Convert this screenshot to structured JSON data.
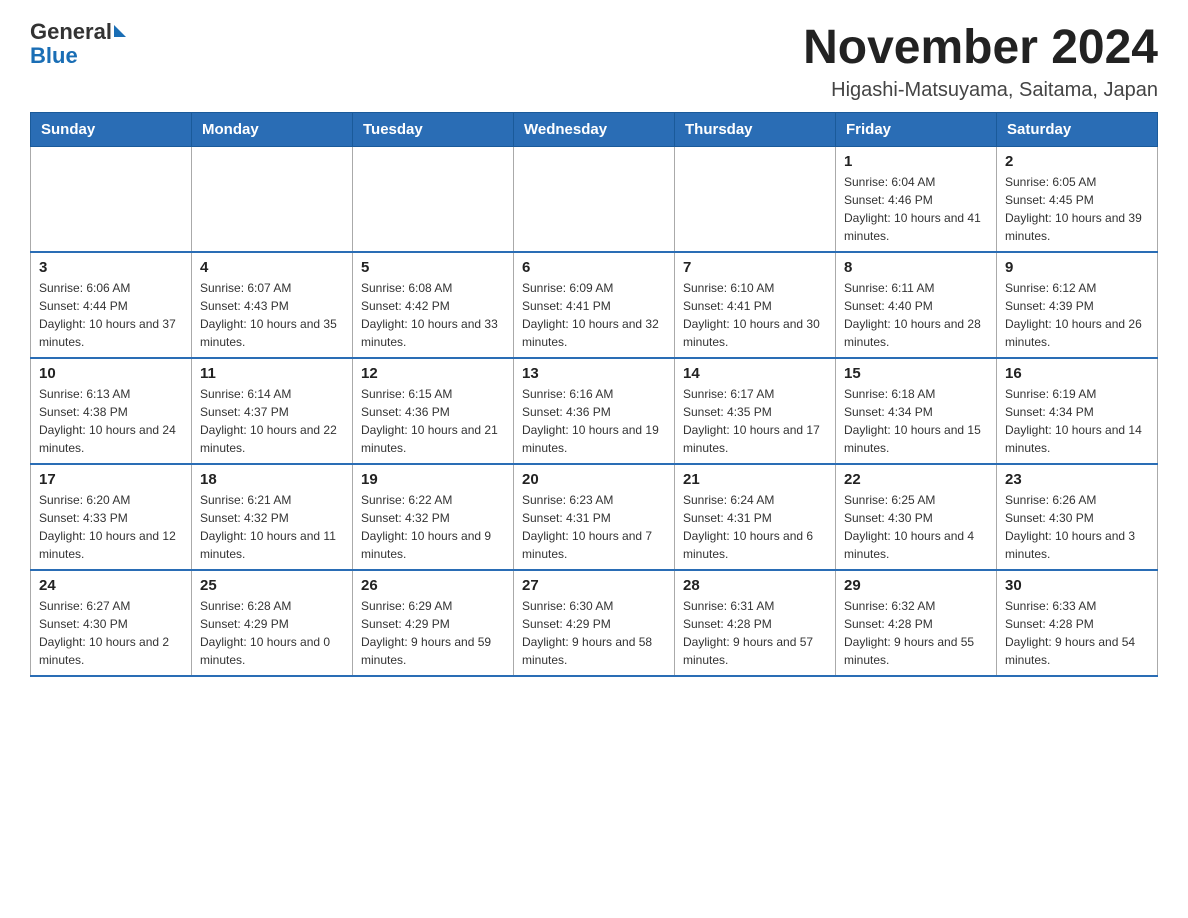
{
  "logo": {
    "text_general": "General",
    "text_blue": "Blue"
  },
  "header": {
    "month_title": "November 2024",
    "location": "Higashi-Matsuyama, Saitama, Japan"
  },
  "weekdays": [
    "Sunday",
    "Monday",
    "Tuesday",
    "Wednesday",
    "Thursday",
    "Friday",
    "Saturday"
  ],
  "weeks": [
    [
      {
        "day": "",
        "sunrise": "",
        "sunset": "",
        "daylight": ""
      },
      {
        "day": "",
        "sunrise": "",
        "sunset": "",
        "daylight": ""
      },
      {
        "day": "",
        "sunrise": "",
        "sunset": "",
        "daylight": ""
      },
      {
        "day": "",
        "sunrise": "",
        "sunset": "",
        "daylight": ""
      },
      {
        "day": "",
        "sunrise": "",
        "sunset": "",
        "daylight": ""
      },
      {
        "day": "1",
        "sunrise": "Sunrise: 6:04 AM",
        "sunset": "Sunset: 4:46 PM",
        "daylight": "Daylight: 10 hours and 41 minutes."
      },
      {
        "day": "2",
        "sunrise": "Sunrise: 6:05 AM",
        "sunset": "Sunset: 4:45 PM",
        "daylight": "Daylight: 10 hours and 39 minutes."
      }
    ],
    [
      {
        "day": "3",
        "sunrise": "Sunrise: 6:06 AM",
        "sunset": "Sunset: 4:44 PM",
        "daylight": "Daylight: 10 hours and 37 minutes."
      },
      {
        "day": "4",
        "sunrise": "Sunrise: 6:07 AM",
        "sunset": "Sunset: 4:43 PM",
        "daylight": "Daylight: 10 hours and 35 minutes."
      },
      {
        "day": "5",
        "sunrise": "Sunrise: 6:08 AM",
        "sunset": "Sunset: 4:42 PM",
        "daylight": "Daylight: 10 hours and 33 minutes."
      },
      {
        "day": "6",
        "sunrise": "Sunrise: 6:09 AM",
        "sunset": "Sunset: 4:41 PM",
        "daylight": "Daylight: 10 hours and 32 minutes."
      },
      {
        "day": "7",
        "sunrise": "Sunrise: 6:10 AM",
        "sunset": "Sunset: 4:41 PM",
        "daylight": "Daylight: 10 hours and 30 minutes."
      },
      {
        "day": "8",
        "sunrise": "Sunrise: 6:11 AM",
        "sunset": "Sunset: 4:40 PM",
        "daylight": "Daylight: 10 hours and 28 minutes."
      },
      {
        "day": "9",
        "sunrise": "Sunrise: 6:12 AM",
        "sunset": "Sunset: 4:39 PM",
        "daylight": "Daylight: 10 hours and 26 minutes."
      }
    ],
    [
      {
        "day": "10",
        "sunrise": "Sunrise: 6:13 AM",
        "sunset": "Sunset: 4:38 PM",
        "daylight": "Daylight: 10 hours and 24 minutes."
      },
      {
        "day": "11",
        "sunrise": "Sunrise: 6:14 AM",
        "sunset": "Sunset: 4:37 PM",
        "daylight": "Daylight: 10 hours and 22 minutes."
      },
      {
        "day": "12",
        "sunrise": "Sunrise: 6:15 AM",
        "sunset": "Sunset: 4:36 PM",
        "daylight": "Daylight: 10 hours and 21 minutes."
      },
      {
        "day": "13",
        "sunrise": "Sunrise: 6:16 AM",
        "sunset": "Sunset: 4:36 PM",
        "daylight": "Daylight: 10 hours and 19 minutes."
      },
      {
        "day": "14",
        "sunrise": "Sunrise: 6:17 AM",
        "sunset": "Sunset: 4:35 PM",
        "daylight": "Daylight: 10 hours and 17 minutes."
      },
      {
        "day": "15",
        "sunrise": "Sunrise: 6:18 AM",
        "sunset": "Sunset: 4:34 PM",
        "daylight": "Daylight: 10 hours and 15 minutes."
      },
      {
        "day": "16",
        "sunrise": "Sunrise: 6:19 AM",
        "sunset": "Sunset: 4:34 PM",
        "daylight": "Daylight: 10 hours and 14 minutes."
      }
    ],
    [
      {
        "day": "17",
        "sunrise": "Sunrise: 6:20 AM",
        "sunset": "Sunset: 4:33 PM",
        "daylight": "Daylight: 10 hours and 12 minutes."
      },
      {
        "day": "18",
        "sunrise": "Sunrise: 6:21 AM",
        "sunset": "Sunset: 4:32 PM",
        "daylight": "Daylight: 10 hours and 11 minutes."
      },
      {
        "day": "19",
        "sunrise": "Sunrise: 6:22 AM",
        "sunset": "Sunset: 4:32 PM",
        "daylight": "Daylight: 10 hours and 9 minutes."
      },
      {
        "day": "20",
        "sunrise": "Sunrise: 6:23 AM",
        "sunset": "Sunset: 4:31 PM",
        "daylight": "Daylight: 10 hours and 7 minutes."
      },
      {
        "day": "21",
        "sunrise": "Sunrise: 6:24 AM",
        "sunset": "Sunset: 4:31 PM",
        "daylight": "Daylight: 10 hours and 6 minutes."
      },
      {
        "day": "22",
        "sunrise": "Sunrise: 6:25 AM",
        "sunset": "Sunset: 4:30 PM",
        "daylight": "Daylight: 10 hours and 4 minutes."
      },
      {
        "day": "23",
        "sunrise": "Sunrise: 6:26 AM",
        "sunset": "Sunset: 4:30 PM",
        "daylight": "Daylight: 10 hours and 3 minutes."
      }
    ],
    [
      {
        "day": "24",
        "sunrise": "Sunrise: 6:27 AM",
        "sunset": "Sunset: 4:30 PM",
        "daylight": "Daylight: 10 hours and 2 minutes."
      },
      {
        "day": "25",
        "sunrise": "Sunrise: 6:28 AM",
        "sunset": "Sunset: 4:29 PM",
        "daylight": "Daylight: 10 hours and 0 minutes."
      },
      {
        "day": "26",
        "sunrise": "Sunrise: 6:29 AM",
        "sunset": "Sunset: 4:29 PM",
        "daylight": "Daylight: 9 hours and 59 minutes."
      },
      {
        "day": "27",
        "sunrise": "Sunrise: 6:30 AM",
        "sunset": "Sunset: 4:29 PM",
        "daylight": "Daylight: 9 hours and 58 minutes."
      },
      {
        "day": "28",
        "sunrise": "Sunrise: 6:31 AM",
        "sunset": "Sunset: 4:28 PM",
        "daylight": "Daylight: 9 hours and 57 minutes."
      },
      {
        "day": "29",
        "sunrise": "Sunrise: 6:32 AM",
        "sunset": "Sunset: 4:28 PM",
        "daylight": "Daylight: 9 hours and 55 minutes."
      },
      {
        "day": "30",
        "sunrise": "Sunrise: 6:33 AM",
        "sunset": "Sunset: 4:28 PM",
        "daylight": "Daylight: 9 hours and 54 minutes."
      }
    ]
  ]
}
